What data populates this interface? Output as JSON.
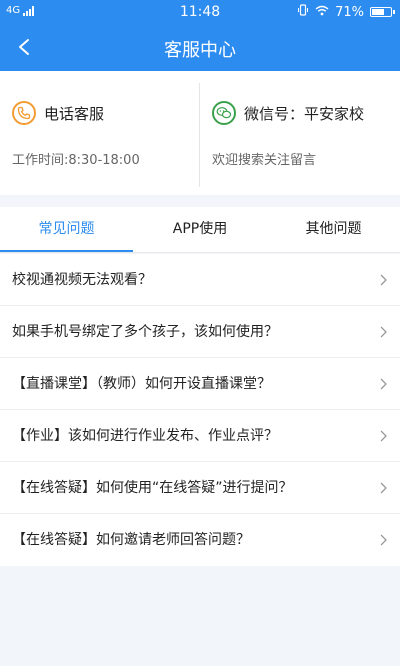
{
  "status_bar": {
    "network": "4G",
    "time": "11:48",
    "battery": "71%",
    "battery_level": 0.71
  },
  "header": {
    "title": "客服中心"
  },
  "contact": {
    "phone": {
      "title": "电话客服",
      "subtitle": "工作时间:8:30-18:00"
    },
    "wechat": {
      "title": "微信号：平安家校",
      "subtitle": "欢迎搜索关注留言"
    }
  },
  "tabs": [
    {
      "label": "常见问题",
      "active": true
    },
    {
      "label": "APP使用",
      "active": false
    },
    {
      "label": "其他问题",
      "active": false
    }
  ],
  "faq": [
    "校视通视频无法观看？",
    "如果手机号绑定了多个孩子，该如何使用？",
    "【直播课堂】（教师）如何开设直播课堂？",
    "【作业】该如何进行作业发布、作业点评？",
    "【在线答疑】如何使用“在线答疑”进行提问？",
    "【在线答疑】如何邀请老师回答问题？"
  ],
  "colors": {
    "primary": "#2d8cf0",
    "phone_icon": "#f39c33",
    "wechat_icon": "#3aa14a"
  }
}
